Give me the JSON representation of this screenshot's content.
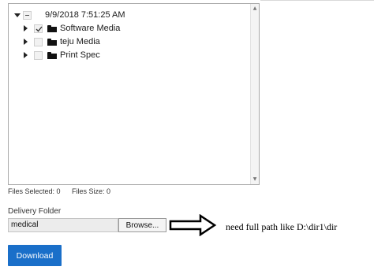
{
  "tree": {
    "root": {
      "label": "9/9/2018 7:51:25 AM",
      "expanded": true,
      "check_state": "partial"
    },
    "children": [
      {
        "label": "Software Media",
        "check_state": "checked",
        "icon": "folder-icon"
      },
      {
        "label": "teju Media",
        "check_state": "unchecked",
        "icon": "folder-icon"
      },
      {
        "label": "Print Spec",
        "check_state": "unchecked",
        "icon": "folder-icon"
      }
    ]
  },
  "stats": {
    "files_selected": "Files Selected: 0",
    "files_size": "Files Size: 0"
  },
  "delivery": {
    "label": "Delivery Folder",
    "value": "medical",
    "browse_label": "Browse..."
  },
  "annotation": {
    "text": "need full path like D:\\dir1\\dir",
    "icon": "right-arrow-icon"
  },
  "download_label": "Download",
  "colors": {
    "accent": "#1a6fc9",
    "panel_border": "#a9a9a9",
    "input_bg": "#ececec"
  }
}
